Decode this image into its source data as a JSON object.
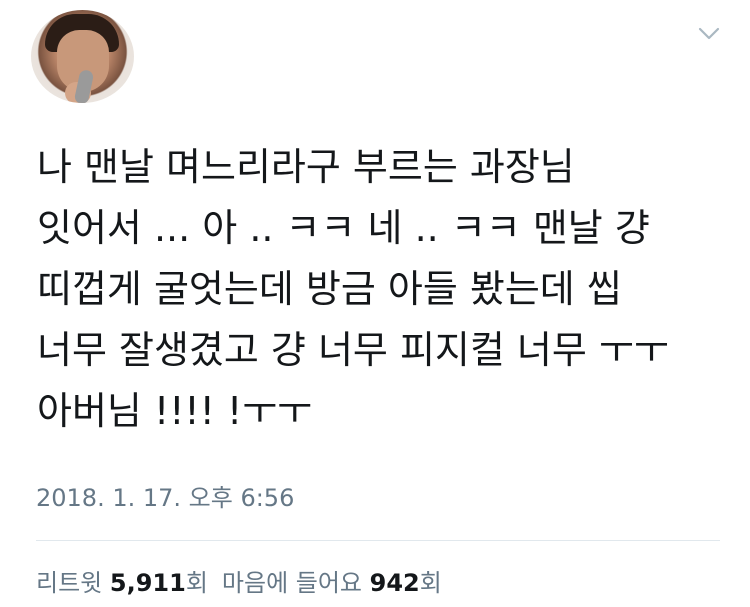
{
  "profile": {
    "avatar_icon": "profile-photo"
  },
  "menu": {
    "icon": "chevron-down-icon"
  },
  "tweet": {
    "lines": [
      "나 맨날 며느리라구 부르는 과장님",
      "잇어서 ... 아 .. ㅋㅋ 네 .. ㅋㅋ 맨날 걍",
      "띠껍게 굴엇는데 방금 아들 봤는데 씹",
      "너무 잘생겼고 걍 너무 피지컬 너무  ㅜㅜ",
      "아버님 !!!! !ㅜㅜ"
    ],
    "timestamp": "2018. 1. 17. 오후 6:56"
  },
  "stats": {
    "retweets": {
      "label": "리트윗",
      "count": "5,911",
      "unit": "회"
    },
    "likes": {
      "label": "마음에 들어요",
      "count": "942",
      "unit": "회"
    }
  },
  "colors": {
    "text": "#14171a",
    "secondary": "#657786",
    "divider": "#e1e8ed",
    "chevron": "#aab8c2"
  }
}
